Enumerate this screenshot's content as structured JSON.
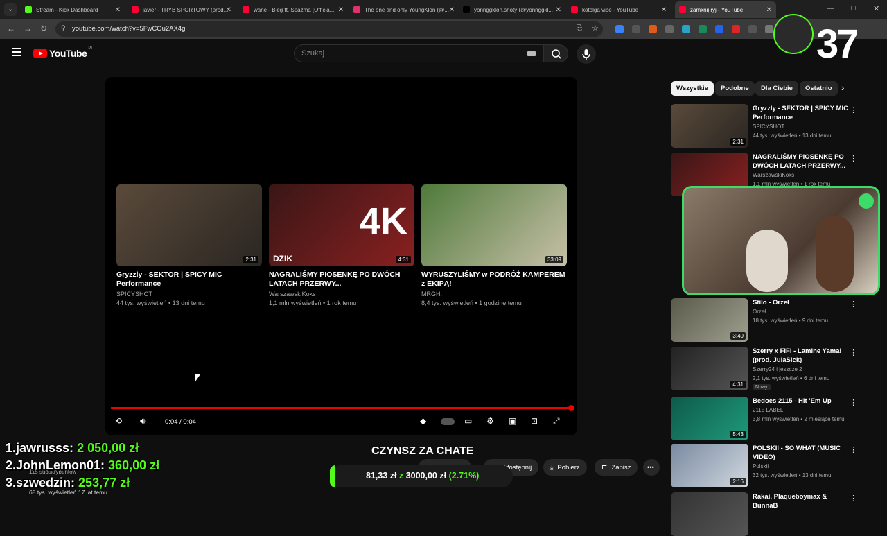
{
  "browser": {
    "tabs": [
      {
        "label": "Stream - Kick Dashboard",
        "color": "#53fc18"
      },
      {
        "label": "javier - TRYB SPORTOWY (prod...",
        "color": "#ff0033"
      },
      {
        "label": "wane - Bieg ft. Spazma [Officia...",
        "color": "#ff0033"
      },
      {
        "label": "The one and only YoungKlon (@...",
        "color": "#e1306c"
      },
      {
        "label": "yonnggklon.shoty (@yonnggkl...",
        "color": "#000000"
      },
      {
        "label": "kotolga vibe - YouTube",
        "color": "#ff0033"
      },
      {
        "label": "zamknij ryj - YouTube",
        "color": "#ff0033"
      }
    ],
    "url": "youtube.com/watch?v=5FwCOu2AX4g"
  },
  "youtube": {
    "logo_text": "YouTube",
    "country": "PL",
    "search_placeholder": "Szukaj"
  },
  "player": {
    "time": "0:04 / 0:04",
    "progress": 1.0,
    "endcards": [
      {
        "title": "Gryzzly - SEKTOR | SPICY MIC Performance",
        "channel": "SPICYSHOT",
        "meta": "44 tys. wyświetleń • 13 dni temu",
        "duration": "2:31",
        "colors": [
          "#5a4a3a",
          "#2a2622"
        ]
      },
      {
        "title": "NAGRALIŚMY PIOSENKĘ PO DWÓCH LATACH PRZERWY...",
        "channel": "WarszawskiKoks",
        "meta": "1,1 mln wyświetleń • 1 rok temu",
        "duration": "4:31",
        "overlay": "4K",
        "tag": "DZIK",
        "colors": [
          "#3a1616",
          "#8a2020"
        ]
      },
      {
        "title": "WYRUSZYLIŚMY w PODRÓŻ KAMPEREM z EKIPĄ!",
        "channel": "MRGH.",
        "meta": "8,4 tys. wyświetleń • 1 godzinę temu",
        "duration": "33:09",
        "colors": [
          "#4f7a3a",
          "#c7c0a8"
        ]
      }
    ]
  },
  "video": {
    "title": "CZYNSZ ZA CHATE",
    "likes": "108",
    "share": "Udostępnij",
    "download": "Pobierz",
    "save": "Zapisz",
    "views_line": "68 tys. wyświetleń  17 lat temu",
    "subscribers": "115 subskrybentów"
  },
  "chips": [
    "Wszystkie",
    "Podobne",
    "Dla Ciebie",
    "Ostatnio"
  ],
  "sidebar": [
    {
      "title": "Gryzzly - SEKTOR | SPICY MIC Performance",
      "channel": "SPICYSHOT",
      "meta": "44 tys. wyświetleń • 13 dni temu",
      "duration": "2:31",
      "colors": [
        "#5a4a3a",
        "#2a2622"
      ]
    },
    {
      "title": "NAGRALIŚMY PIOSENKĘ PO DWÓCH LATACH PRZERWY...",
      "channel": "WarszawskiKoks",
      "meta": "1,1 mln wyświetleń • 1 rok temu",
      "duration": "4:31",
      "colors": [
        "#3a1616",
        "#8a2020"
      ]
    },
    {
      "title": "Stilo - Orzeł",
      "channel": "Orzeł",
      "meta": "18 tys. wyświetleń • 9 dni temu",
      "duration": "3:40",
      "colors": [
        "#5a5a4a",
        "#a0a090"
      ]
    },
    {
      "title": "Szerry x FIFI - Lamine Yamal (prod. JulaSick)",
      "channel": "Szerry24 i jeszcze 2",
      "meta": "2,1 tys. wyświetleń • 6 dni temu",
      "duration": "4:31",
      "badge": "Nowy",
      "colors": [
        "#222",
        "#555"
      ]
    },
    {
      "title": "Bedoes 2115 - Hit 'Em Up",
      "channel": "2115 LABEL",
      "meta": "3,8 mln wyświetleń • 2 miesiące temu",
      "duration": "5:43",
      "colors": [
        "#0e5a4a",
        "#1f9a7a"
      ]
    },
    {
      "title": "POLSKII - SO WHAT (MUSIC VIDEO)",
      "channel": "Polskii",
      "meta": "32 tys. wyświetleń • 13 dni temu",
      "duration": "2:16",
      "colors": [
        "#7a8aa0",
        "#d0d8e0"
      ]
    },
    {
      "title": "Rakai, Plaqueboymax & BunnaB",
      "channel": "",
      "meta": "",
      "duration": "",
      "colors": [
        "#333",
        "#555"
      ]
    }
  ],
  "overlay": {
    "leaderboard": [
      {
        "rank": "1.",
        "name": "jawrusss:",
        "amount": "2 050,00 zł"
      },
      {
        "rank": "2.",
        "name": "JohnLemon01:",
        "amount": "360,00 zł"
      },
      {
        "rank": "3.",
        "name": "szwedzin:",
        "amount": "253,77 zł"
      }
    ],
    "goal": {
      "current": "81,33 zł",
      "sep": "z",
      "target": "3000,00 zł",
      "pct": "(2.71%)",
      "fraction": 0.0271
    },
    "counter": "37"
  },
  "colors": {
    "accent": "#ff0000",
    "kick_green": "#53fc18",
    "cam_border": "#3ddc6a"
  }
}
